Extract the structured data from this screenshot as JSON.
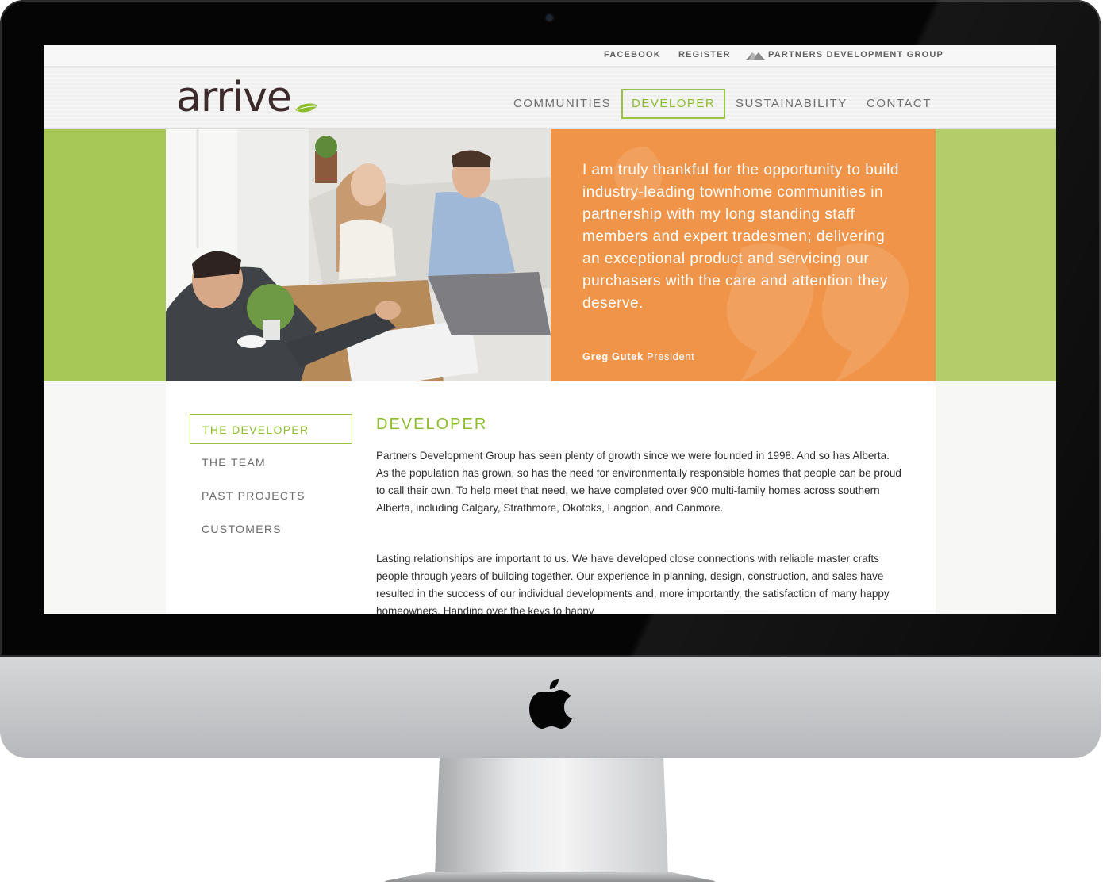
{
  "topbar": {
    "facebook": "FACEBOOK",
    "register": "REGISTER",
    "partners": "PARTNERS DEVELOPMENT GROUP"
  },
  "header": {
    "logo": "arrive",
    "nav": [
      {
        "label": "COMMUNITIES",
        "active": false
      },
      {
        "label": "DEVELOPER",
        "active": true
      },
      {
        "label": "SUSTAINABILITY",
        "active": false
      },
      {
        "label": "CONTACT",
        "active": false
      }
    ]
  },
  "hero": {
    "quote": "I am truly thankful for the opportunity to build industry-leading townhome communities in partnership with my long standing staff members and expert tradesmen; delivering an exceptional product and servicing our purchasers with the care and attention they deserve.",
    "author_name": "Greg Gutek",
    "author_title": "President"
  },
  "sidebar": {
    "items": [
      {
        "label": "THE DEVELOPER",
        "active": true
      },
      {
        "label": "THE TEAM",
        "active": false
      },
      {
        "label": "PAST PROJECTS",
        "active": false
      },
      {
        "label": "CUSTOMERS",
        "active": false
      }
    ]
  },
  "main": {
    "title": "DEVELOPER",
    "paragraphs": [
      "Partners Development Group has seen plenty of growth since we were founded in 1998. And so has Alberta. As the population has grown, so has the need for environmentally responsible homes that people can be proud to call their own. To help meet that need, we have completed over 900 multi-family homes across southern Alberta, including Calgary, Strathmore, Okotoks, Langdon, and Canmore.",
      "Lasting relationships are important to us. We have developed close connections with reliable master crafts people through years of building together. Our experience in planning, design, construction, and sales have resulted in the success of our individual developments and, more importantly, the satisfaction of many happy homeowners. Handing over the keys to happy"
    ]
  },
  "colors": {
    "brand_green": "#8bbd2c",
    "hero_green": "#a7c856",
    "quote_orange": "#f0944a",
    "logo_brown": "#3d2a2c"
  },
  "icons": {
    "apple": "apple-logo-icon",
    "partners": "partners-logo-icon",
    "leaf": "leaf-icon",
    "quote": "quote-marks-icon"
  }
}
